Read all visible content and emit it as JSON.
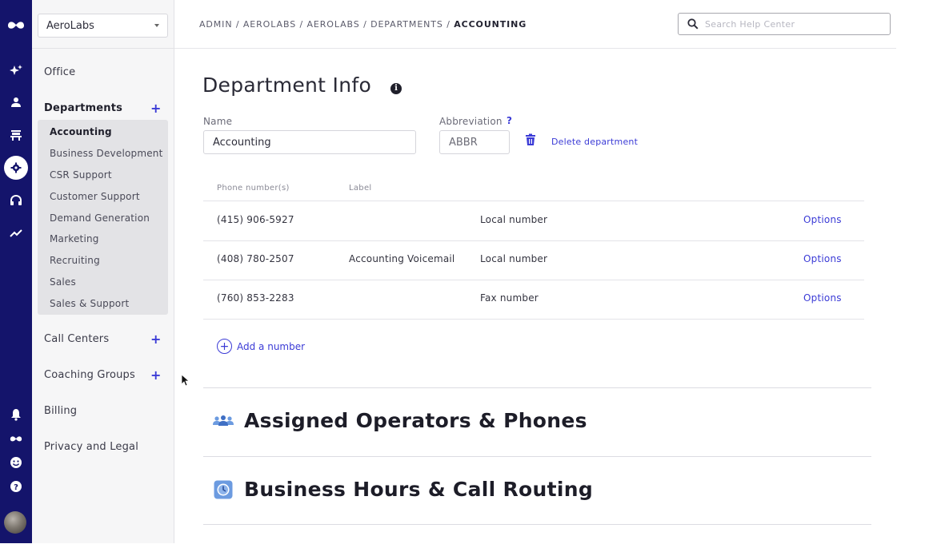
{
  "org_selector": {
    "value": "AeroLabs"
  },
  "nav": {
    "office": "Office",
    "departments": "Departments",
    "department_items": [
      "Accounting",
      "Business Development",
      "CSR Support",
      "Customer Support",
      "Demand Generation",
      "Marketing",
      "Recruiting",
      "Sales",
      "Sales & Support"
    ],
    "active_department": "Accounting",
    "call_centers": "Call Centers",
    "coaching_groups": "Coaching Groups",
    "billing": "Billing",
    "privacy": "Privacy and Legal",
    "add_symbol": "+"
  },
  "breadcrumb": {
    "path": "ADMIN / AEROLABS / AEROLABS / DEPARTMENTS / ",
    "current": "ACCOUNTING"
  },
  "search": {
    "placeholder": "Search Help Center"
  },
  "page": {
    "title": "Department Info",
    "info_icon": "i"
  },
  "form": {
    "name_label": "Name",
    "name_value": "Accounting",
    "abbr_label": "Abbreviation",
    "abbr_help": "?",
    "abbr_placeholder": "ABBR",
    "delete_label": "Delete department"
  },
  "numbers": {
    "header_phone": "Phone number(s)",
    "header_label": "Label",
    "rows": [
      {
        "phone": "(415) 906-5927",
        "label": "",
        "type": "Local number",
        "options": "Options"
      },
      {
        "phone": "(408) 780-2507",
        "label": "Accounting Voicemail",
        "type": "Local number",
        "options": "Options"
      },
      {
        "phone": "(760) 853-2283",
        "label": "",
        "type": "Fax number",
        "options": "Options"
      }
    ],
    "add_label": "Add a number"
  },
  "sections": {
    "operators": "Assigned Operators & Phones",
    "hours": "Business Hours & Call Routing"
  },
  "colors": {
    "rail": "#14146b",
    "accent": "#3b3bd6",
    "section_icon": "#5b8fd9"
  },
  "icons": {
    "rail_top": [
      "dialpad-logo-icon",
      "sparkle-icon",
      "user-icon",
      "office-icon",
      "settings-icon",
      "headset-icon",
      "analytics-icon"
    ],
    "rail_bottom": [
      "bell-icon",
      "dialpad-logo-icon",
      "smiley-icon",
      "help-icon"
    ]
  }
}
